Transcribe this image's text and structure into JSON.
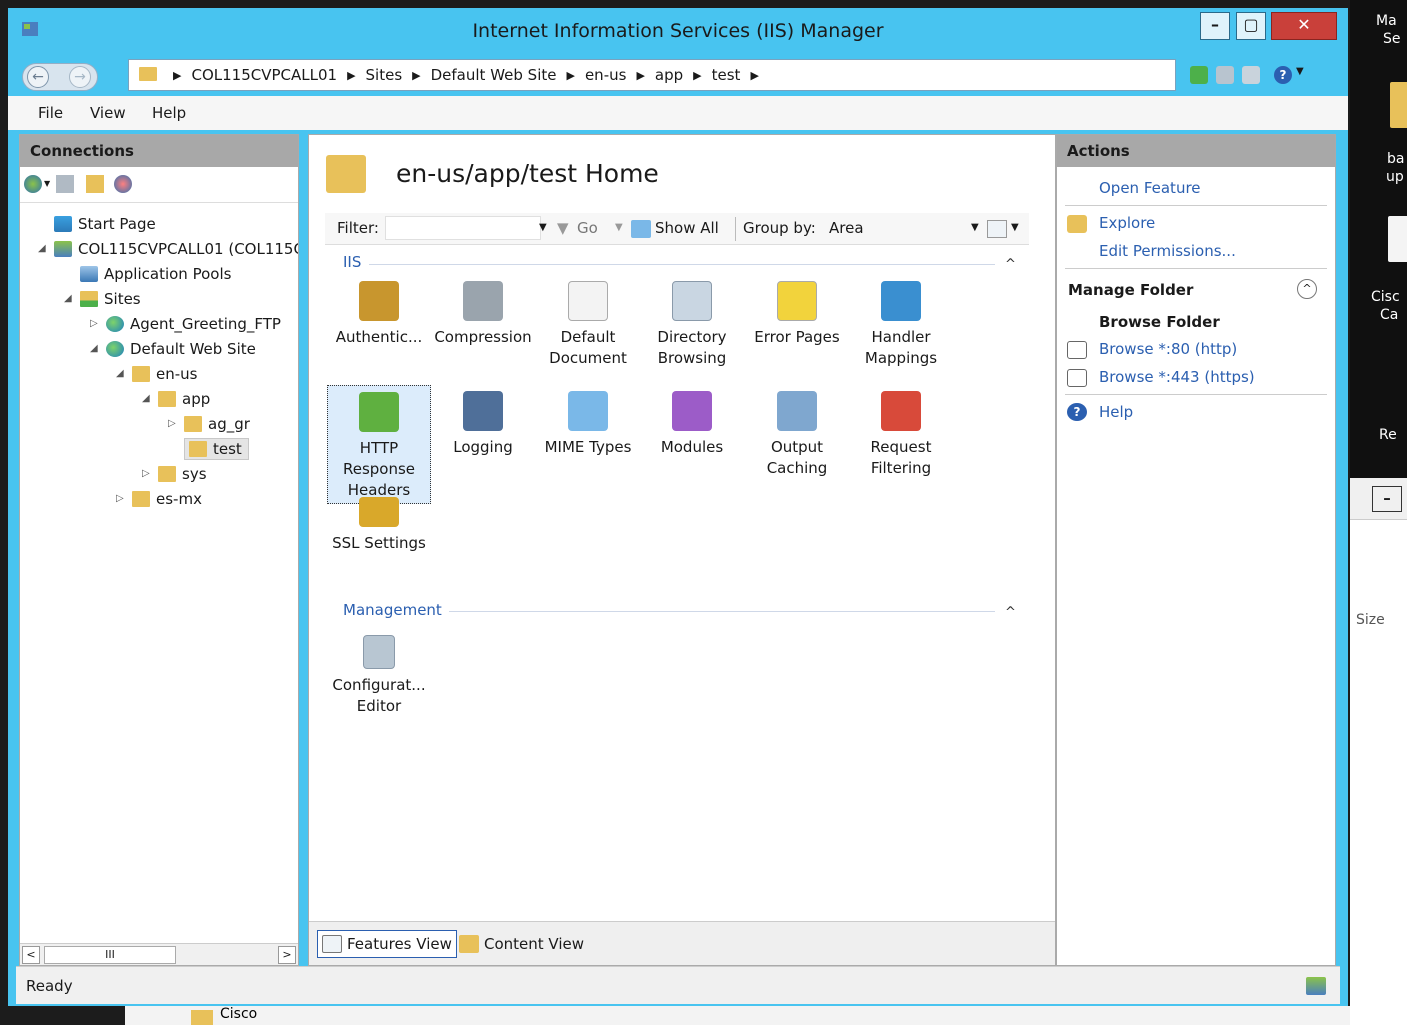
{
  "window": {
    "title": "Internet Information Services (IIS) Manager"
  },
  "breadcrumbs": [
    "COL115CVPCALL01",
    "Sites",
    "Default Web Site",
    "en-us",
    "app",
    "test"
  ],
  "menu": [
    "File",
    "View",
    "Help"
  ],
  "connections": {
    "header": "Connections",
    "tree": [
      {
        "label": "Start Page",
        "icon": "start-page-icon"
      },
      {
        "label": "COL115CVPCALL01 (COL115C",
        "icon": "server-icon",
        "expanded": true
      },
      {
        "label": "Application Pools",
        "icon": "app-pool-icon"
      },
      {
        "label": "Sites",
        "icon": "sites-icon",
        "expanded": true
      },
      {
        "label": "Agent_Greeting_FTP",
        "icon": "globe-icon"
      },
      {
        "label": "Default Web Site",
        "icon": "globe-icon",
        "expanded": true
      },
      {
        "label": "en-us",
        "icon": "folder-icon",
        "expanded": true
      },
      {
        "label": "app",
        "icon": "folder-icon",
        "expanded": true
      },
      {
        "label": "ag_gr",
        "icon": "folder-icon"
      },
      {
        "label": "test",
        "icon": "folder-icon",
        "selected": true
      },
      {
        "label": "sys",
        "icon": "folder-icon"
      },
      {
        "label": "es-mx",
        "icon": "folder-icon"
      }
    ],
    "scroll_thumb": "III"
  },
  "center": {
    "title": "en-us/app/test Home",
    "filter_label": "Filter:",
    "go_label": "Go",
    "show_all_label": "Show All",
    "group_by_label": "Group by:",
    "group_by_value": "Area",
    "groups": [
      {
        "name": "IIS",
        "features": [
          {
            "label": "Authentic...",
            "color": "#c8962e"
          },
          {
            "label": "Compression",
            "color": "#9aa4ad"
          },
          {
            "label": "Default Document",
            "color": "#f3f3f3"
          },
          {
            "label": "Directory Browsing",
            "color": "#c9d6e2"
          },
          {
            "label": "Error Pages",
            "color": "#f2d33c"
          },
          {
            "label": "Handler Mappings",
            "color": "#3a8fd0"
          },
          {
            "label": "HTTP Response Headers",
            "color": "#5fb040",
            "selected": true
          },
          {
            "label": "Logging",
            "color": "#4f6f99"
          },
          {
            "label": "MIME Types",
            "color": "#7ab8e8"
          },
          {
            "label": "Modules",
            "color": "#9c5cc8"
          },
          {
            "label": "Output Caching",
            "color": "#7fa7cf"
          },
          {
            "label": "Request Filtering",
            "color": "#d84a3a"
          },
          {
            "label": "SSL Settings",
            "color": "#d9a82a"
          }
        ]
      },
      {
        "name": "Management",
        "features": [
          {
            "label": "Configurat... Editor",
            "color": "#b8c6d2"
          }
        ]
      }
    ],
    "view_tabs": [
      "Features View",
      "Content View"
    ]
  },
  "actions": {
    "header": "Actions",
    "open_feature": "Open Feature",
    "explore": "Explore",
    "edit_permissions": "Edit Permissions...",
    "manage_folder": "Manage Folder",
    "browse_folder": "Browse Folder",
    "browse_80": "Browse *:80 (http)",
    "browse_443": "Browse *:443 (https)",
    "help": "Help"
  },
  "status": "Ready",
  "desktop": {
    "right_texts": [
      "Ma",
      "Se",
      "ba",
      "up",
      "Cisc",
      "Ca",
      "Re",
      "Size"
    ],
    "bottom_text": "Cisco"
  }
}
